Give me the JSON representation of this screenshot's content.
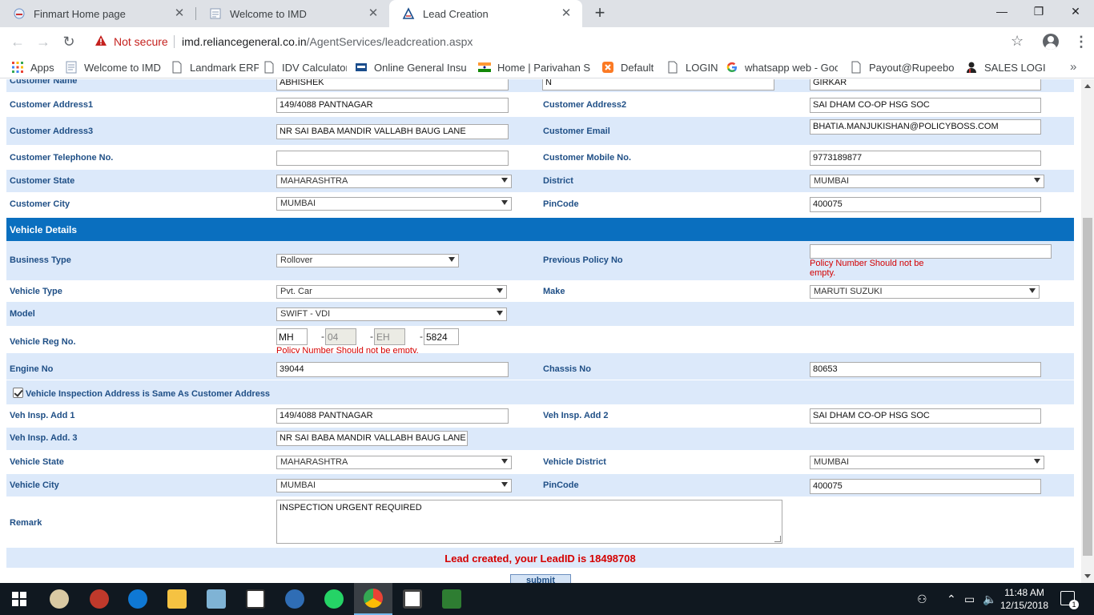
{
  "browser": {
    "tabs": [
      {
        "title": "Finmart Home page",
        "active": false
      },
      {
        "title": "Welcome to IMD",
        "active": false
      },
      {
        "title": "Lead Creation",
        "active": true
      }
    ],
    "security_label": "Not secure",
    "url_host": "imd.reliancegeneral.co.in",
    "url_path": "/AgentServices/leadcreation.aspx",
    "bookmarks": [
      "Apps",
      "Welcome to IMD",
      "Landmark ERP",
      "IDV Calculator",
      "Online General Insura",
      "Home | Parivahan Sev",
      "Default",
      "LOGIN",
      "whatsapp web - Goo",
      "Payout@Rupeeboss",
      "SALES LOGIN"
    ]
  },
  "form": {
    "customer_name": {
      "label": "Customer Name",
      "first": "ABHISHEK",
      "middle": "N",
      "last": "GIRKAR"
    },
    "address1": {
      "label": "Customer Address1",
      "value": "149/4088 PANTNAGAR"
    },
    "address2": {
      "label": "Customer Address2",
      "value": "SAI DHAM CO-OP HSG SOC"
    },
    "address3": {
      "label": "Customer Address3",
      "value": "NR SAI BABA MANDIR VALLABH BAUG LANE"
    },
    "email": {
      "label": "Customer Email",
      "value": "BHATIA.MANJUKISHAN@POLICYBOSS.COM"
    },
    "telephone": {
      "label": "Customer Telephone No.",
      "value": ""
    },
    "mobile": {
      "label": "Customer Mobile No.",
      "value": "9773189877"
    },
    "state": {
      "label": "Customer State",
      "value": "MAHARASHTRA"
    },
    "district": {
      "label": "District",
      "value": "MUMBAI"
    },
    "city": {
      "label": "Customer City",
      "value": "MUMBAI"
    },
    "pincode": {
      "label": "PinCode",
      "value": "400075"
    },
    "vehicle_section": "Vehicle Details",
    "business_type": {
      "label": "Business Type",
      "value": "Rollover"
    },
    "prev_policy": {
      "label": "Previous Policy No",
      "value": "",
      "error": "Policy Number Should not be empty."
    },
    "vehicle_type": {
      "label": "Vehicle Type",
      "value": "Pvt. Car"
    },
    "make": {
      "label": "Make",
      "value": "MARUTI SUZUKI"
    },
    "model": {
      "label": "Model",
      "value": "SWIFT - VDI"
    },
    "reg_no": {
      "label": "Vehicle Reg No.",
      "part1": "MH",
      "part2": "04",
      "part3": "EH",
      "part4": "5824",
      "error": "Policy Number Should not be empty."
    },
    "engine_no": {
      "label": "Engine No",
      "value": "39044"
    },
    "chassis_no": {
      "label": "Chassis No",
      "value": "80653"
    },
    "same_address": {
      "label": "Vehicle Inspection Address is Same As Customer Address",
      "checked": true
    },
    "insp_add1": {
      "label": "Veh Insp. Add 1",
      "value": "149/4088 PANTNAGAR"
    },
    "insp_add2": {
      "label": "Veh Insp. Add 2",
      "value": "SAI DHAM CO-OP HSG SOC"
    },
    "insp_add3": {
      "label": "Veh Insp. Add. 3",
      "value": "NR SAI BABA MANDIR VALLABH BAUG LANE"
    },
    "vehicle_state": {
      "label": "Vehicle State",
      "value": "MAHARASHTRA"
    },
    "vehicle_district": {
      "label": "Vehicle District",
      "value": "MUMBAI"
    },
    "vehicle_city": {
      "label": "Vehicle City",
      "value": "MUMBAI"
    },
    "vehicle_pincode": {
      "label": "PinCode",
      "value": "400075"
    },
    "remark": {
      "label": "Remark",
      "value": "INSPECTION URGENT REQUIRED"
    },
    "success_message": "Lead created, your LeadID is 18498708",
    "submit_label": "submit"
  },
  "taskbar": {
    "time": "11:48 AM",
    "date": "12/15/2018",
    "notification_count": "1"
  },
  "colors": {
    "label_blue": "#1f4f86",
    "row_blue": "#dce9fa",
    "section_blue": "#0a6fbf",
    "error_red": "#d40000"
  }
}
